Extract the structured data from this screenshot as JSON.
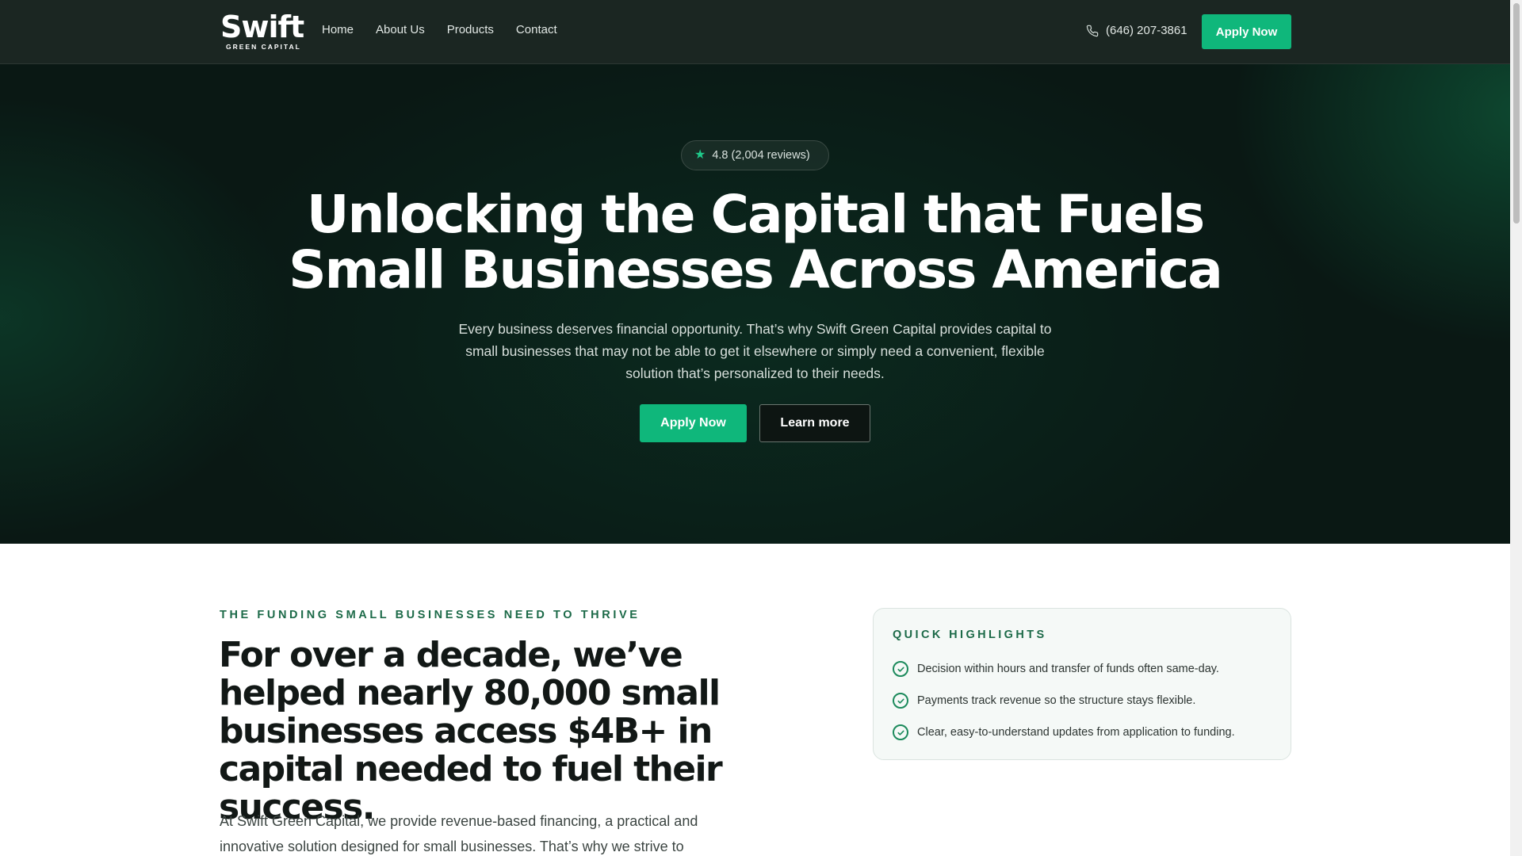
{
  "nav": {
    "logo_word": "Swift",
    "logo_sub": "GREEN CAPITAL",
    "links": [
      "Home",
      "About Us",
      "Products",
      "Contact"
    ],
    "phone": "(646) 207-3861",
    "apply_label": "Apply Now"
  },
  "hero": {
    "rating": "4.8 (2,004 reviews)",
    "title": "Unlocking the Capital that Fuels Small Businesses Across America",
    "description": "Every business deserves financial opportunity. That’s why Swift Green Capital provides capital to small businesses that may not be able to get it elsewhere or simply need a convenient, flexible solution that’s personalized to their needs.",
    "primary_button": "Apply Now",
    "secondary_button": "Learn more"
  },
  "section": {
    "eyebrow": "THE FUNDING SMALL BUSINESSES NEED TO THRIVE",
    "title": "For over a decade, we’ve helped nearly 80,000 small businesses access $4B+ in capital needed to fuel their success.",
    "body": "At Swift Green Capital, we provide revenue-based financing, a practical and innovative solution designed for small businesses. That’s why we strive to"
  },
  "highlights": {
    "title": "QUICK HIGHLIGHTS",
    "items": [
      "Decision within hours and transfer of funds often same-day.",
      "Payments track revenue so the structure stays flexible.",
      "Clear, easy-to-understand updates from application to funding."
    ]
  },
  "colors": {
    "accent": "#0fb77b",
    "nav_bg": "#1b2622",
    "hero_bg": "#0a1612",
    "eyebrow": "#1c6a48"
  }
}
